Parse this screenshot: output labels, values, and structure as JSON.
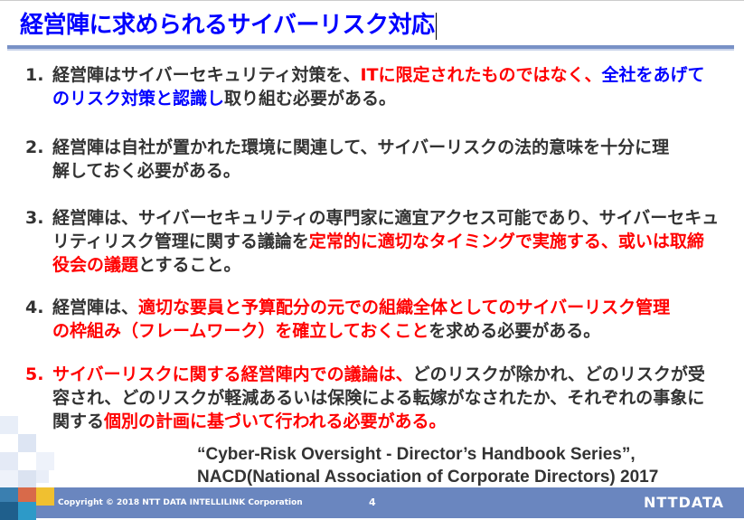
{
  "title": "経営陣に求められるサイバーリスク対応",
  "colors": {
    "title": "#0000ff",
    "text": "#333333",
    "red": "#ff0000",
    "blue": "#0000ff",
    "footer": "#6a86bf"
  },
  "items": [
    {
      "number": "1.",
      "number_color": "dark",
      "lines": [
        [
          {
            "t": "経営陣はサイバーセキュリティ対策を、",
            "c": "dark"
          },
          {
            "t": "ITに限定されたものではなく、",
            "c": "red"
          },
          {
            "t": "全社をあげて",
            "c": "blue"
          }
        ],
        [
          {
            "t": "のリスク対策と認識し",
            "c": "blue"
          },
          {
            "t": "取り組む必要がある。",
            "c": "dark"
          }
        ]
      ]
    },
    {
      "number": "2.",
      "number_color": "dark",
      "lines": [
        [
          {
            "t": "経営陣は自社が置かれた環境に関連して、サイバーリスクの法的意味を十分に理",
            "c": "dark"
          }
        ],
        [
          {
            "t": "解しておく必要がある。",
            "c": "dark"
          }
        ]
      ]
    },
    {
      "number": "3.",
      "number_color": "dark",
      "lines": [
        [
          {
            "t": "経営陣は、サイバーセキュリティの専門家に適宜アクセス可能であり、サイバーセキュ",
            "c": "dark"
          }
        ],
        [
          {
            "t": "リティリスク管理に関する議論を",
            "c": "dark"
          },
          {
            "t": "定常的に適切なタイミングで実施する、或いは取締",
            "c": "red"
          }
        ],
        [
          {
            "t": "役会の議題",
            "c": "red"
          },
          {
            "t": "とすること。",
            "c": "dark"
          }
        ]
      ]
    },
    {
      "number": "4.",
      "number_color": "dark",
      "lines": [
        [
          {
            "t": "経営陣は、",
            "c": "dark"
          },
          {
            "t": "適切な要員と予算配分の元での組織全体としてのサイバーリスク管理",
            "c": "red"
          }
        ],
        [
          {
            "t": "の枠組み（フレームワーク）を確立しておくこと",
            "c": "red"
          },
          {
            "t": "を求める必要がある。",
            "c": "dark"
          }
        ]
      ]
    },
    {
      "number": "5.",
      "number_color": "red",
      "lines": [
        [
          {
            "t": "サイバーリスクに関する経営陣内での議論は、",
            "c": "red"
          },
          {
            "t": "どのリスクが除かれ、どのリスクが受",
            "c": "dark"
          }
        ],
        [
          {
            "t": "容され、どのリスクが軽減あるいは保険による転嫁がなされたか、それぞれの事象に",
            "c": "dark"
          }
        ],
        [
          {
            "t": "関する",
            "c": "dark"
          },
          {
            "t": "個別の計画に基づいて行われる必要がある。",
            "c": "red"
          }
        ]
      ]
    }
  ],
  "citation": {
    "line1": "“Cyber-Risk Oversight  - Director’s Handbook Series”,",
    "line2": "NACD(National Association of Corporate Directors) 2017"
  },
  "footer": {
    "copyright": "Copyright © 2018  NTT DATA INTELLILINK Corporation",
    "page_number": "4",
    "logo": "NTTDATA"
  }
}
